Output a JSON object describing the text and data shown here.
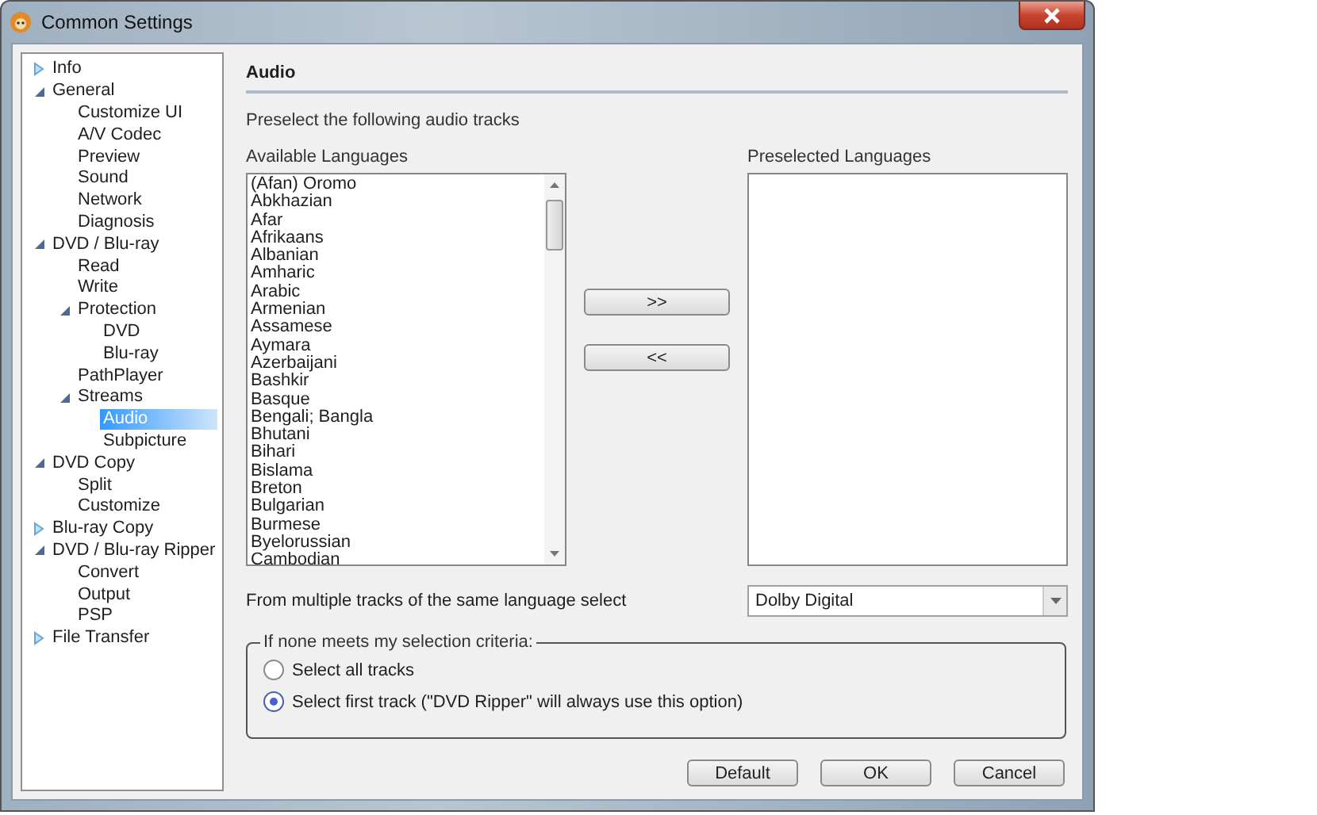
{
  "window": {
    "title": "Common Settings"
  },
  "tree": [
    {
      "label": "Info",
      "expanded": false,
      "selected": false
    },
    {
      "label": "General",
      "expanded": true,
      "selected": false,
      "children": [
        {
          "label": "Customize UI",
          "selected": false
        },
        {
          "label": "A/V Codec",
          "selected": false
        },
        {
          "label": "Preview",
          "selected": false
        },
        {
          "label": "Sound",
          "selected": false
        },
        {
          "label": "Network",
          "selected": false
        },
        {
          "label": "Diagnosis",
          "selected": false
        }
      ]
    },
    {
      "label": "DVD / Blu-ray",
      "expanded": true,
      "selected": false,
      "children": [
        {
          "label": "Read",
          "selected": false
        },
        {
          "label": "Write",
          "selected": false
        },
        {
          "label": "Protection",
          "expanded": true,
          "selected": false,
          "children": [
            {
              "label": "DVD",
              "selected": false
            },
            {
              "label": "Blu-ray",
              "selected": false
            }
          ]
        },
        {
          "label": "PathPlayer",
          "selected": false
        },
        {
          "label": "Streams",
          "expanded": true,
          "selected": false,
          "children": [
            {
              "label": "Audio",
              "selected": true
            },
            {
              "label": "Subpicture",
              "selected": false
            }
          ]
        }
      ]
    },
    {
      "label": "DVD Copy",
      "expanded": true,
      "selected": false,
      "children": [
        {
          "label": "Split",
          "selected": false
        },
        {
          "label": "Customize",
          "selected": false
        }
      ]
    },
    {
      "label": "Blu-ray Copy",
      "expanded": false,
      "selected": false
    },
    {
      "label": "DVD / Blu-ray Ripper",
      "expanded": true,
      "selected": false,
      "children": [
        {
          "label": "Convert",
          "selected": false
        },
        {
          "label": "Output",
          "selected": false
        },
        {
          "label": "PSP",
          "selected": false
        }
      ]
    },
    {
      "label": "File Transfer",
      "expanded": false,
      "selected": false
    }
  ],
  "page": {
    "heading": "Audio",
    "intro": "Preselect the following audio tracks",
    "available": {
      "label": "Available Languages",
      "items": [
        "(Afan) Oromo",
        "Abkhazian",
        "Afar",
        "Afrikaans",
        "Albanian",
        "Amharic",
        "Arabic",
        "Armenian",
        "Assamese",
        "Aymara",
        "Azerbaijani",
        "Bashkir",
        "Basque",
        "Bengali; Bangla",
        "Bhutani",
        "Bihari",
        "Bislama",
        "Breton",
        "Bulgarian",
        "Burmese",
        "Byelorussian",
        "Cambodian"
      ]
    },
    "move_buttons": [
      ">>",
      "<<"
    ],
    "preselected": {
      "label": "Preselected Languages"
    },
    "multiple": {
      "label": "From multiple tracks of the same language select",
      "value": "Dolby Digital"
    },
    "fallback": {
      "legend": "If none meets my selection criteria:",
      "options": [
        {
          "label": "Select all tracks",
          "selected": false
        },
        {
          "label": "Select first track (\"DVD Ripper\" will always use this option)",
          "selected": true
        }
      ]
    }
  },
  "buttons": [
    "Default",
    "OK",
    "Cancel"
  ]
}
